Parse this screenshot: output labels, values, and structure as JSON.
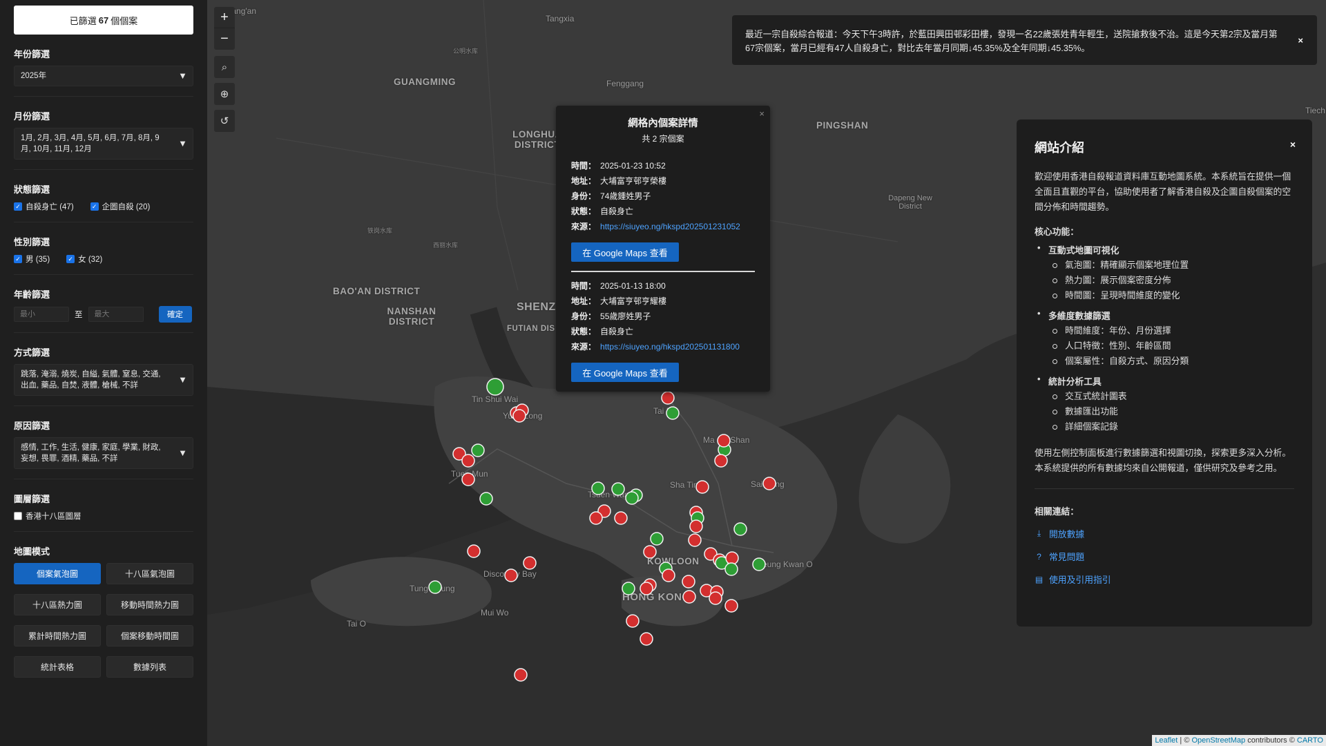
{
  "sidebar": {
    "filtered_prefix": "已篩選",
    "filtered_count": "67",
    "filtered_suffix": "個個案",
    "year": {
      "title": "年份篩選",
      "value": "2025年"
    },
    "month": {
      "title": "月份篩選",
      "value": "1月, 2月, 3月, 4月, 5月, 6月, 7月, 8月, 9月, 10月, 11月, 12月"
    },
    "status": {
      "title": "狀態篩選",
      "options": [
        {
          "label": "自殺身亡 (47)",
          "checked": true
        },
        {
          "label": "企圖自殺 (20)",
          "checked": true
        }
      ]
    },
    "gender": {
      "title": "性別篩選",
      "options": [
        {
          "label": "男 (35)",
          "checked": true
        },
        {
          "label": "女 (32)",
          "checked": true
        }
      ]
    },
    "age": {
      "title": "年齡篩選",
      "min_placeholder": "最小",
      "to": "至",
      "max_placeholder": "最大",
      "confirm": "確定"
    },
    "method": {
      "title": "方式篩選",
      "value": "跳落, 淹溺, 燒炭, 自縊, 氣體, 窒息, 交通, 出血, 藥品, 自焚, 液體, 槍械, 不詳"
    },
    "reason": {
      "title": "原因篩選",
      "value": "感情, 工作, 生活, 健康, 家庭, 學業, 財政, 妄想, 畏罪, 酒精, 藥品, 不詳"
    },
    "layer": {
      "title": "圖層篩選",
      "option": "香港十八區圖層",
      "checked": false
    },
    "mode": {
      "title": "地圖模式",
      "buttons": [
        "個案氣泡圖",
        "十八區氣泡圖",
        "十八區熱力圖",
        "移動時間熱力圖",
        "累計時間熱力圖",
        "個案移動時間圖",
        "統計表格",
        "數據列表"
      ],
      "active": "個案氣泡圖"
    }
  },
  "map": {
    "places": [
      {
        "name": "Chang'an",
        "cls": ""
      },
      {
        "name": "Tangxia",
        "cls": ""
      },
      {
        "name": "GUANGMING",
        "cls": "big"
      },
      {
        "name": "Fenggang",
        "cls": ""
      },
      {
        "name": "LONGHUA DISTRICT",
        "cls": "big"
      },
      {
        "name": "PINGSHAN",
        "cls": "big"
      },
      {
        "name": "Dapeng New District",
        "cls": ""
      },
      {
        "name": "BAO'AN DISTRICT",
        "cls": "big"
      },
      {
        "name": "NANSHAN DISTRICT",
        "cls": "big"
      },
      {
        "name": "SHENZ",
        "cls": "big"
      },
      {
        "name": "FUTIAN DIS",
        "cls": "big"
      },
      {
        "name": "Tin Shui Wai",
        "cls": ""
      },
      {
        "name": "Yuen Long",
        "cls": ""
      },
      {
        "name": "Tuen Mun",
        "cls": ""
      },
      {
        "name": "Tai Po",
        "cls": ""
      },
      {
        "name": "Ma On Shan",
        "cls": ""
      },
      {
        "name": "Sha Tin",
        "cls": ""
      },
      {
        "name": "Sai Kung",
        "cls": ""
      },
      {
        "name": "Tsuen Wan",
        "cls": ""
      },
      {
        "name": "KOWLOON",
        "cls": "big"
      },
      {
        "name": "Tseung Kwan O",
        "cls": ""
      },
      {
        "name": "HONG KONG",
        "cls": "big"
      },
      {
        "name": "Discovery Bay",
        "cls": ""
      },
      {
        "name": "Tung Chung",
        "cls": ""
      },
      {
        "name": "Mui Wo",
        "cls": ""
      },
      {
        "name": "Tai O",
        "cls": ""
      },
      {
        "name": "Tiech",
        "cls": ""
      },
      {
        "name": "公明水库",
        "cls": "small"
      },
      {
        "name": "铁岗水库",
        "cls": "small"
      },
      {
        "name": "西丽水库",
        "cls": "small"
      }
    ],
    "controls": {
      "zoom_in": "+",
      "zoom_out": "−"
    },
    "attribution": {
      "leaflet": "Leaflet",
      "sep": " | © ",
      "osm": "OpenStreetMap",
      "contrib": " contributors © ",
      "carto": "CARTO"
    }
  },
  "news": {
    "text": "最近一宗自殺綜合報道：今天下午3時許，於藍田興田邨彩田樓，發現一名22歲張姓青年輕生，送院搶救後不治。這是今天第2宗及當月第67宗個案，當月已經有47人自殺身亡，對比去年當月同期↓45.35%及全年同期↓45.35%。",
    "close": "×"
  },
  "popup": {
    "title": "網格內個案詳情",
    "subtitle": "共 2 宗個案",
    "close": "×",
    "labels": {
      "time": "時間：",
      "address": "地址：",
      "identity": "身份：",
      "status": "狀態：",
      "source": "來源："
    },
    "cases": [
      {
        "time": "2025-01-23 10:52",
        "address": "大埔富亨邨亨榮樓",
        "identity": "74歲鍾姓男子",
        "status": "自殺身亡",
        "source": "https://siuyeo.ng/hkspd202501231052",
        "button": "在 Google Maps 查看"
      },
      {
        "time": "2025-01-13 18:00",
        "address": "大埔富亨邨亨耀樓",
        "identity": "55歲廖姓男子",
        "status": "自殺身亡",
        "source": "https://siuyeo.ng/hkspd202501131800",
        "button": "在 Google Maps 查看"
      }
    ]
  },
  "intro": {
    "title": "網站介紹",
    "close": "×",
    "desc": "歡迎使用香港自殺報道資料庫互動地圖系統。本系統旨在提供一個全面且直觀的平台，協助使用者了解香港自殺及企圖自殺個案的空間分佈和時間趨勢。",
    "core_label": "核心功能：",
    "features": [
      {
        "title": "互動式地圖可視化",
        "items": [
          "氣泡圖：精確顯示個案地理位置",
          "熱力圖：展示個案密度分佈",
          "時間圖：呈現時間維度的變化"
        ]
      },
      {
        "title": "多維度數據篩選",
        "items": [
          "時間維度：年份、月份選擇",
          "人口特徵：性別、年齡區間",
          "個案屬性：自殺方式、原因分類"
        ]
      },
      {
        "title": "統計分析工具",
        "items": [
          "交互式統計圖表",
          "數據匯出功能",
          "詳細個案記錄"
        ]
      }
    ],
    "footer": "使用左側控制面板進行數據篩選和視圖切換，探索更多深入分析。本系統提供的所有數據均來自公開報道，僅供研究及參考之用。",
    "links_label": "相關連結：",
    "links": [
      {
        "label": "開放數據",
        "icon": "download-icon"
      },
      {
        "label": "常見問題",
        "icon": "help-circle-icon"
      },
      {
        "label": "使用及引用指引",
        "icon": "document-icon"
      }
    ]
  },
  "colors": {
    "death": "#d32f2f",
    "attempt": "#2e9e35",
    "accent": "#1565c0",
    "link": "#4ea3ff"
  }
}
